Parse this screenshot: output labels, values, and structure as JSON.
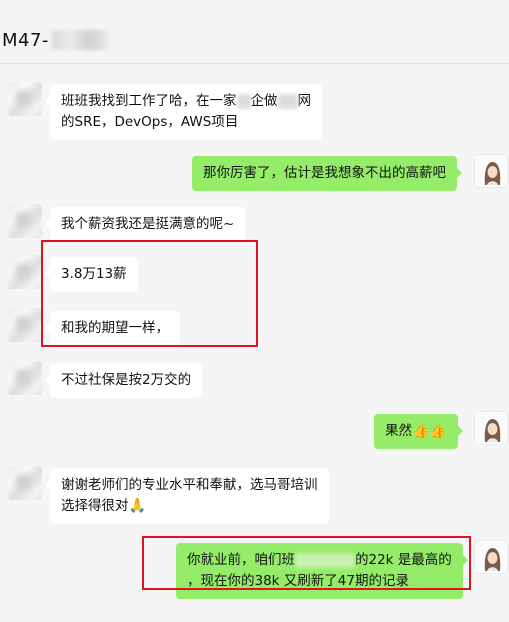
{
  "chat": {
    "title": "M47-"
  },
  "messages": [
    {
      "side": "left",
      "parts": [
        "班班我找到工作了哈，在一家",
        "企做",
        "网"
      ],
      "line2": "的SRE，DevOps，AWS项目"
    },
    {
      "side": "right",
      "text": "那你厉害了，估计是我想象不出的高薪吧"
    },
    {
      "side": "left",
      "text": "我个薪资我还是挺满意的呢~"
    },
    {
      "side": "left",
      "text": "3.8万13薪"
    },
    {
      "side": "left",
      "text": "和我的期望一样，"
    },
    {
      "side": "left",
      "text": "不过社保是按2万交的"
    },
    {
      "side": "right",
      "text": "果然",
      "emoji": "👍👍"
    },
    {
      "side": "left",
      "line1": "谢谢老师们的专业水平和奉献，选马哥培训",
      "line2": "选择得很对",
      "emoji": "🙏"
    },
    {
      "side": "right",
      "parts": [
        "你就业前，咱们班",
        "的22k 是最高的"
      ],
      "line2": "，现在你的38k 又刷新了47期的记录"
    }
  ],
  "colors": {
    "sent_bubble": "#95ec69",
    "received_bubble": "#ffffff",
    "annotation": "#e0141e",
    "background": "#f5f5f5"
  }
}
